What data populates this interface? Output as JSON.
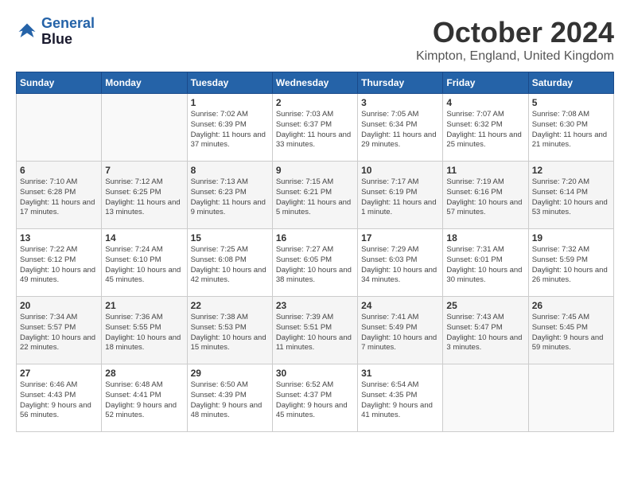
{
  "logo": {
    "line1": "General",
    "line2": "Blue"
  },
  "title": "October 2024",
  "location": "Kimpton, England, United Kingdom",
  "days_of_week": [
    "Sunday",
    "Monday",
    "Tuesday",
    "Wednesday",
    "Thursday",
    "Friday",
    "Saturday"
  ],
  "weeks": [
    [
      {
        "day": "",
        "info": ""
      },
      {
        "day": "",
        "info": ""
      },
      {
        "day": "1",
        "info": "Sunrise: 7:02 AM\nSunset: 6:39 PM\nDaylight: 11 hours and 37 minutes."
      },
      {
        "day": "2",
        "info": "Sunrise: 7:03 AM\nSunset: 6:37 PM\nDaylight: 11 hours and 33 minutes."
      },
      {
        "day": "3",
        "info": "Sunrise: 7:05 AM\nSunset: 6:34 PM\nDaylight: 11 hours and 29 minutes."
      },
      {
        "day": "4",
        "info": "Sunrise: 7:07 AM\nSunset: 6:32 PM\nDaylight: 11 hours and 25 minutes."
      },
      {
        "day": "5",
        "info": "Sunrise: 7:08 AM\nSunset: 6:30 PM\nDaylight: 11 hours and 21 minutes."
      }
    ],
    [
      {
        "day": "6",
        "info": "Sunrise: 7:10 AM\nSunset: 6:28 PM\nDaylight: 11 hours and 17 minutes."
      },
      {
        "day": "7",
        "info": "Sunrise: 7:12 AM\nSunset: 6:25 PM\nDaylight: 11 hours and 13 minutes."
      },
      {
        "day": "8",
        "info": "Sunrise: 7:13 AM\nSunset: 6:23 PM\nDaylight: 11 hours and 9 minutes."
      },
      {
        "day": "9",
        "info": "Sunrise: 7:15 AM\nSunset: 6:21 PM\nDaylight: 11 hours and 5 minutes."
      },
      {
        "day": "10",
        "info": "Sunrise: 7:17 AM\nSunset: 6:19 PM\nDaylight: 11 hours and 1 minute."
      },
      {
        "day": "11",
        "info": "Sunrise: 7:19 AM\nSunset: 6:16 PM\nDaylight: 10 hours and 57 minutes."
      },
      {
        "day": "12",
        "info": "Sunrise: 7:20 AM\nSunset: 6:14 PM\nDaylight: 10 hours and 53 minutes."
      }
    ],
    [
      {
        "day": "13",
        "info": "Sunrise: 7:22 AM\nSunset: 6:12 PM\nDaylight: 10 hours and 49 minutes."
      },
      {
        "day": "14",
        "info": "Sunrise: 7:24 AM\nSunset: 6:10 PM\nDaylight: 10 hours and 45 minutes."
      },
      {
        "day": "15",
        "info": "Sunrise: 7:25 AM\nSunset: 6:08 PM\nDaylight: 10 hours and 42 minutes."
      },
      {
        "day": "16",
        "info": "Sunrise: 7:27 AM\nSunset: 6:05 PM\nDaylight: 10 hours and 38 minutes."
      },
      {
        "day": "17",
        "info": "Sunrise: 7:29 AM\nSunset: 6:03 PM\nDaylight: 10 hours and 34 minutes."
      },
      {
        "day": "18",
        "info": "Sunrise: 7:31 AM\nSunset: 6:01 PM\nDaylight: 10 hours and 30 minutes."
      },
      {
        "day": "19",
        "info": "Sunrise: 7:32 AM\nSunset: 5:59 PM\nDaylight: 10 hours and 26 minutes."
      }
    ],
    [
      {
        "day": "20",
        "info": "Sunrise: 7:34 AM\nSunset: 5:57 PM\nDaylight: 10 hours and 22 minutes."
      },
      {
        "day": "21",
        "info": "Sunrise: 7:36 AM\nSunset: 5:55 PM\nDaylight: 10 hours and 18 minutes."
      },
      {
        "day": "22",
        "info": "Sunrise: 7:38 AM\nSunset: 5:53 PM\nDaylight: 10 hours and 15 minutes."
      },
      {
        "day": "23",
        "info": "Sunrise: 7:39 AM\nSunset: 5:51 PM\nDaylight: 10 hours and 11 minutes."
      },
      {
        "day": "24",
        "info": "Sunrise: 7:41 AM\nSunset: 5:49 PM\nDaylight: 10 hours and 7 minutes."
      },
      {
        "day": "25",
        "info": "Sunrise: 7:43 AM\nSunset: 5:47 PM\nDaylight: 10 hours and 3 minutes."
      },
      {
        "day": "26",
        "info": "Sunrise: 7:45 AM\nSunset: 5:45 PM\nDaylight: 9 hours and 59 minutes."
      }
    ],
    [
      {
        "day": "27",
        "info": "Sunrise: 6:46 AM\nSunset: 4:43 PM\nDaylight: 9 hours and 56 minutes."
      },
      {
        "day": "28",
        "info": "Sunrise: 6:48 AM\nSunset: 4:41 PM\nDaylight: 9 hours and 52 minutes."
      },
      {
        "day": "29",
        "info": "Sunrise: 6:50 AM\nSunset: 4:39 PM\nDaylight: 9 hours and 48 minutes."
      },
      {
        "day": "30",
        "info": "Sunrise: 6:52 AM\nSunset: 4:37 PM\nDaylight: 9 hours and 45 minutes."
      },
      {
        "day": "31",
        "info": "Sunrise: 6:54 AM\nSunset: 4:35 PM\nDaylight: 9 hours and 41 minutes."
      },
      {
        "day": "",
        "info": ""
      },
      {
        "day": "",
        "info": ""
      }
    ]
  ]
}
